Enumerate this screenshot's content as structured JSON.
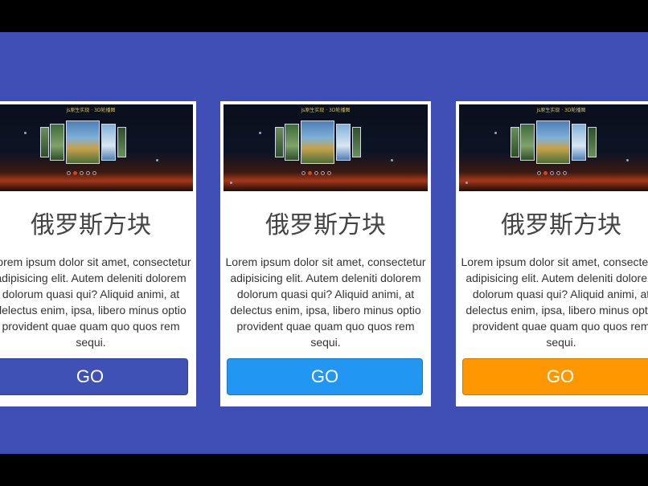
{
  "cards": [
    {
      "thumb_caption": "js原生实现 · 3D轮播图",
      "title": "俄罗斯方块",
      "description": "Lorem ipsum dolor sit amet, consectetur adipisicing elit. Autem deleniti dolorem dolorum quasi qui? Aliquid animi, at delectus enim, ipsa, libero minus optio provident quae quam quo quos rem sequi.",
      "button_label": "GO",
      "button_color": "#3f51b5"
    },
    {
      "thumb_caption": "js原生实现 · 3D轮播图",
      "title": "俄罗斯方块",
      "description": "Lorem ipsum dolor sit amet, consectetur adipisicing elit. Autem deleniti dolorem dolorum quasi qui? Aliquid animi, at delectus enim, ipsa, libero minus optio provident quae quam quo quos rem sequi.",
      "button_label": "GO",
      "button_color": "#2196f3"
    },
    {
      "thumb_caption": "js原生实现 · 3D轮播图",
      "title": "俄罗斯方块",
      "description": "Lorem ipsum dolor sit amet, consectetur adipisicing elit. Autem deleniti dolorem dolorum quasi qui? Aliquid animi, at delectus enim, ipsa, libero minus optio provident quae quam quo quos rem sequi.",
      "button_label": "GO",
      "button_color": "#ff9800"
    }
  ],
  "colors": {
    "band_background": "#3f4fb5",
    "page_background": "#000000"
  }
}
